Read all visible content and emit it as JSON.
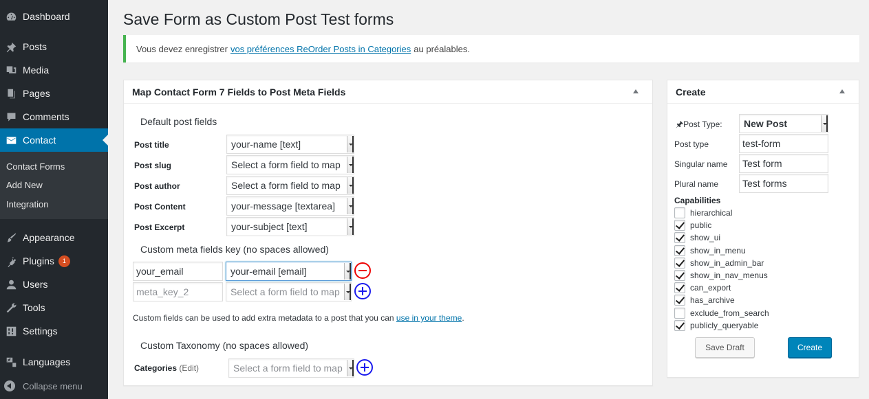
{
  "sidebar": {
    "items": [
      {
        "label": "Dashboard",
        "icon": "dashboard-icon"
      },
      {
        "label": "Posts",
        "icon": "pin-icon"
      },
      {
        "label": "Media",
        "icon": "media-icon"
      },
      {
        "label": "Pages",
        "icon": "pages-icon"
      },
      {
        "label": "Comments",
        "icon": "comment-icon"
      },
      {
        "label": "Contact",
        "icon": "mail-icon"
      },
      {
        "label": "Appearance",
        "icon": "brush-icon"
      },
      {
        "label": "Plugins",
        "icon": "plugin-icon",
        "badge": "1"
      },
      {
        "label": "Users",
        "icon": "user-icon"
      },
      {
        "label": "Tools",
        "icon": "wrench-icon"
      },
      {
        "label": "Settings",
        "icon": "settings-icon"
      },
      {
        "label": "Languages",
        "icon": "translate-icon"
      }
    ],
    "submenu": [
      "Contact Forms",
      "Add New",
      "Integration"
    ],
    "collapse_label": "Collapse menu"
  },
  "page": {
    "title": "Save Form as Custom Post Test forms"
  },
  "notice": {
    "before": "Vous devez enregistrer",
    "link": "vos préférences ReOrder Posts in Categories",
    "after": "au préalables."
  },
  "mapbox": {
    "title": "Map Contact Form 7 Fields to Post Meta Fields",
    "default_heading": "Default post fields",
    "default_fields": [
      {
        "label": "Post title",
        "value": "your-name [text]"
      },
      {
        "label": "Post slug",
        "value": "Select a form field to map"
      },
      {
        "label": "Post author",
        "value": "Select a form field to map"
      },
      {
        "label": "Post Content",
        "value": "your-message [textarea]"
      },
      {
        "label": "Post Excerpt",
        "value": "your-subject [text]"
      }
    ],
    "meta_heading": "Custom meta fields key (no spaces allowed)",
    "meta_rows": [
      {
        "key": "your_email",
        "value": "your-email [email]"
      },
      {
        "key_placeholder": "meta_key_2",
        "value_placeholder": "Select a form field to map"
      }
    ],
    "help_before": "Custom fields can be used to add extra metadata to a post that you can",
    "help_link": "use in your theme",
    "help_after": ".",
    "taxonomy_heading": "Custom Taxonomy (no spaces allowed)",
    "taxonomy_label": "Categories",
    "taxonomy_edit": "(Edit)",
    "taxonomy_placeholder": "Select a form field to map"
  },
  "createbox": {
    "title": "Create",
    "post_type_label": "Post Type:",
    "post_type_value": "New Post",
    "fields": [
      {
        "label": "Post type",
        "value": "test-form"
      },
      {
        "label": "Singular name",
        "value": "Test form"
      },
      {
        "label": "Plural name",
        "value": "Test forms"
      }
    ],
    "capabilities_heading": "Capabilities",
    "capabilities": [
      {
        "label": "hierarchical",
        "checked": false
      },
      {
        "label": "public",
        "checked": true
      },
      {
        "label": "show_ui",
        "checked": true
      },
      {
        "label": "show_in_menu",
        "checked": true
      },
      {
        "label": "show_in_admin_bar",
        "checked": true
      },
      {
        "label": "show_in_nav_menus",
        "checked": true
      },
      {
        "label": "can_export",
        "checked": true
      },
      {
        "label": "has_archive",
        "checked": true
      },
      {
        "label": "exclude_from_search",
        "checked": false
      },
      {
        "label": "publicly_queryable",
        "checked": true
      }
    ],
    "save_draft_label": "Save Draft",
    "create_label": "Create"
  },
  "colors": {
    "sidebar_bg": "#23282d",
    "active_menu": "#0073aa",
    "primary_button": "#0085ba",
    "notice_border": "#46b450",
    "remove_icon": "#e00000",
    "add_icon": "#1a1aee"
  }
}
